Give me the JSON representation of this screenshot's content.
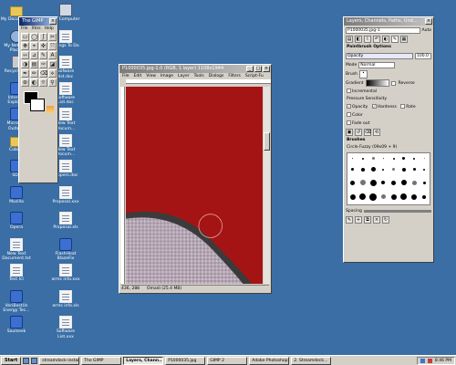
{
  "desktop": {
    "icons_left": [
      {
        "label": "My Documents",
        "icon": "folder"
      },
      {
        "label": "My Network Places",
        "icon": "net"
      },
      {
        "label": "Recycle Bin",
        "icon": "bin"
      },
      {
        "label": "Internet Explorer",
        "icon": "app"
      },
      {
        "label": "Microsoft Outlook",
        "icon": "app"
      },
      {
        "label": "Cobian",
        "icon": "folder"
      },
      {
        "label": "SDP",
        "icon": "app"
      },
      {
        "label": "Mozilla",
        "icon": "app"
      },
      {
        "label": "Opera",
        "icon": "app"
      },
      {
        "label": "New Text Document.txt",
        "icon": "doc"
      },
      {
        "label": "Test Icl",
        "icon": "doc"
      },
      {
        "label": "VeriBestUs Energy Tec...",
        "icon": "app"
      },
      {
        "label": "Soulseek",
        "icon": "app"
      }
    ],
    "icons_mid": [
      {
        "label": "My Computer",
        "icon": "pc"
      },
      {
        "label": "Things To Do",
        "icon": "doc"
      },
      {
        "label": "Sofware list.doc",
        "icon": "doc"
      },
      {
        "label": "Software List.doc",
        "icon": "doc"
      },
      {
        "label": "New Text Docum...",
        "icon": "doc"
      },
      {
        "label": "New Text Docum...",
        "icon": "doc"
      },
      {
        "label": "Zippers.doc",
        "icon": "doc"
      },
      {
        "label": "Proposal.xxx",
        "icon": "doc"
      },
      {
        "label": "Proposal.xls",
        "icon": "doc"
      },
      {
        "label": "FlashHeat BlazeFix",
        "icon": "app"
      },
      {
        "label": "arms info.xxx",
        "icon": "doc"
      },
      {
        "label": "arms info.xls",
        "icon": "doc"
      },
      {
        "label": "Software List.xxx",
        "icon": "doc"
      }
    ]
  },
  "toolbox": {
    "title": "The GIMP",
    "menus": [
      "File",
      "Xtns",
      "Help"
    ],
    "tools": [
      "▭",
      "◯",
      "ʃ",
      "✂",
      "✥",
      "⌖",
      "✜",
      "⤧",
      "⇿",
      "⊿",
      "✎",
      "A",
      "◑",
      "▤",
      "✑",
      "◪",
      "✒",
      "✏",
      "⌫",
      "⟡",
      "⊛",
      "◐",
      "☼",
      "⚲"
    ]
  },
  "image_window": {
    "title": "P1000035.jpg-1.0 (RGB, 1 layer) 1108x1944",
    "menus": [
      "File",
      "Edit",
      "View",
      "Image",
      "Layer",
      "Tools",
      "Dialogs",
      "Filters",
      "Script-Fu"
    ],
    "status_coords": "436, 288",
    "status_info": "Omadi (25.4 MB)",
    "colors": {
      "red": "#a51414",
      "dark": "#4a4a4a",
      "speckle": "#b9aab8"
    }
  },
  "layers_dock": {
    "title": "Layers, Channels, Paths, Und...",
    "image_select": "P1000035.jpg-1",
    "auto_label": "Auto",
    "paintbrush_options": "Paintbrush Options",
    "opacity_label": "Opacity",
    "opacity_value": "100.0",
    "mode_label": "Mode",
    "mode_value": "Normal",
    "brush_label": "Brush",
    "gradient_label": "Gradient",
    "reverse_label": "Reverse",
    "incremental_label": "Incremental",
    "pressure_label": "Pressure Sensitivity",
    "opacity_chk": "Opacity",
    "hardness_chk": "Hardness",
    "rate_chk": "Rate",
    "size_chk": "Size",
    "color_chk": "Color",
    "fade_label": "Fade out",
    "brushes_label": "Brushes",
    "brush_name": "Circle Fuzzy (09x09 + 9)",
    "spacing_label": "Spacing"
  },
  "taskbar": {
    "start": "Start",
    "tasks": [
      "streamdeck-instant",
      "The GIMP",
      "Layers, Chann...",
      "P1000035.jpg",
      "GIMP 2",
      "Adobe Photoshop",
      "2. Streamdeck..."
    ],
    "active_index": 2,
    "clock": "8:46 PM"
  }
}
